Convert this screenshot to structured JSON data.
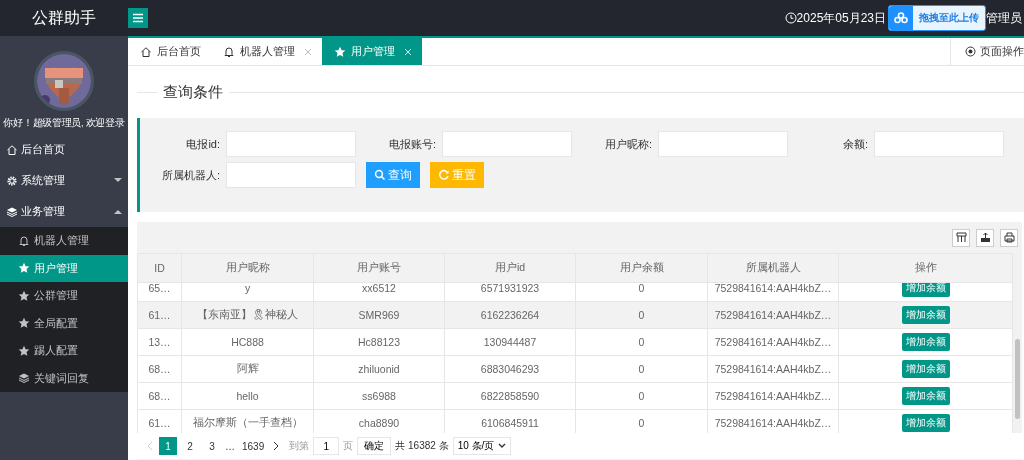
{
  "header": {
    "logo": "公群助手",
    "date": "2025年05月23日",
    "upload_badge": "拖拽至此上传",
    "user": "管理员"
  },
  "sidebar": {
    "greeting": "你好！超级管理员, 欢迎登录",
    "items": [
      {
        "label": "后台首页",
        "kind": "home",
        "selected": false
      },
      {
        "label": "系统管理",
        "kind": "gear",
        "selected": false,
        "expanded": false
      },
      {
        "label": "业务管理",
        "kind": "layers",
        "selected": false,
        "expanded": true,
        "children": [
          {
            "label": "机器人管理",
            "kind": "bell",
            "selected": false
          },
          {
            "label": "用户管理",
            "kind": "star",
            "selected": true
          },
          {
            "label": "公群管理",
            "kind": "star",
            "selected": false
          },
          {
            "label": "全局配置",
            "kind": "star",
            "selected": false
          },
          {
            "label": "踢人配置",
            "kind": "star",
            "selected": false
          },
          {
            "label": "关键词回复",
            "kind": "layers",
            "selected": false
          }
        ]
      }
    ]
  },
  "tabs": [
    {
      "label": "后台首页",
      "kind": "home",
      "closable": false,
      "selected": false
    },
    {
      "label": "机器人管理",
      "kind": "bell",
      "closable": true,
      "selected": false
    },
    {
      "label": "用户管理",
      "kind": "star",
      "closable": true,
      "selected": true
    }
  ],
  "page_ops": "页面操作",
  "query": {
    "legend": "查询条件",
    "fields": [
      {
        "label": "电报id:"
      },
      {
        "label": "电报账号:"
      },
      {
        "label": "用户昵称:"
      },
      {
        "label": "余额:"
      },
      {
        "label": "所属机器人:"
      }
    ],
    "buttons": [
      {
        "label": "查询",
        "kind": "search"
      },
      {
        "label": "重置",
        "kind": "reset"
      }
    ]
  },
  "table": {
    "columns": [
      "ID",
      "用户昵称",
      "用户账号",
      "用户id",
      "用户余额",
      "所属机器人",
      "操作"
    ],
    "rows": [
      {
        "cells": [
          "65…",
          "y",
          "xx6512",
          "6571931923",
          "0",
          "7529841614:AAH4kbZ…"
        ],
        "action": "增加余额",
        "highlighted": false
      },
      {
        "cells": [
          "61…",
          "【东南亚】🎗神秘人",
          "SMR969",
          "6162236264",
          "0",
          "7529841614:AAH4kbZ…"
        ],
        "action": "增加余额",
        "highlighted": true
      },
      {
        "cells": [
          "13…",
          "HC888",
          "Hc88123",
          "130944487",
          "0",
          "7529841614:AAH4kbZ…"
        ],
        "action": "增加余额",
        "highlighted": false
      },
      {
        "cells": [
          "68…",
          "阿辉",
          "zhiluonid",
          "6883046293",
          "0",
          "7529841614:AAH4kbZ…"
        ],
        "action": "增加余额",
        "highlighted": false
      },
      {
        "cells": [
          "68…",
          "hello",
          "ss6988",
          "6822858590",
          "0",
          "7529841614:AAH4kbZ…"
        ],
        "action": "增加余额",
        "highlighted": false
      },
      {
        "cells": [
          "61…",
          "福尔摩斯（一手查档）",
          "cha8890",
          "6106845911",
          "0",
          "7529841614:AAH4kbZ…"
        ],
        "action": "增加余额",
        "highlighted": false
      }
    ]
  },
  "pagination": {
    "pages": [
      {
        "label": "1",
        "selected": true
      },
      {
        "label": "2",
        "selected": false
      },
      {
        "label": "3",
        "selected": false
      }
    ],
    "ellipsis": "…",
    "last": "1639",
    "goto_label": "到第",
    "goto_value": "1",
    "page_unit": "页",
    "confirm": "确定",
    "total": "共 16382 条",
    "page_size": "10 条/页"
  }
}
